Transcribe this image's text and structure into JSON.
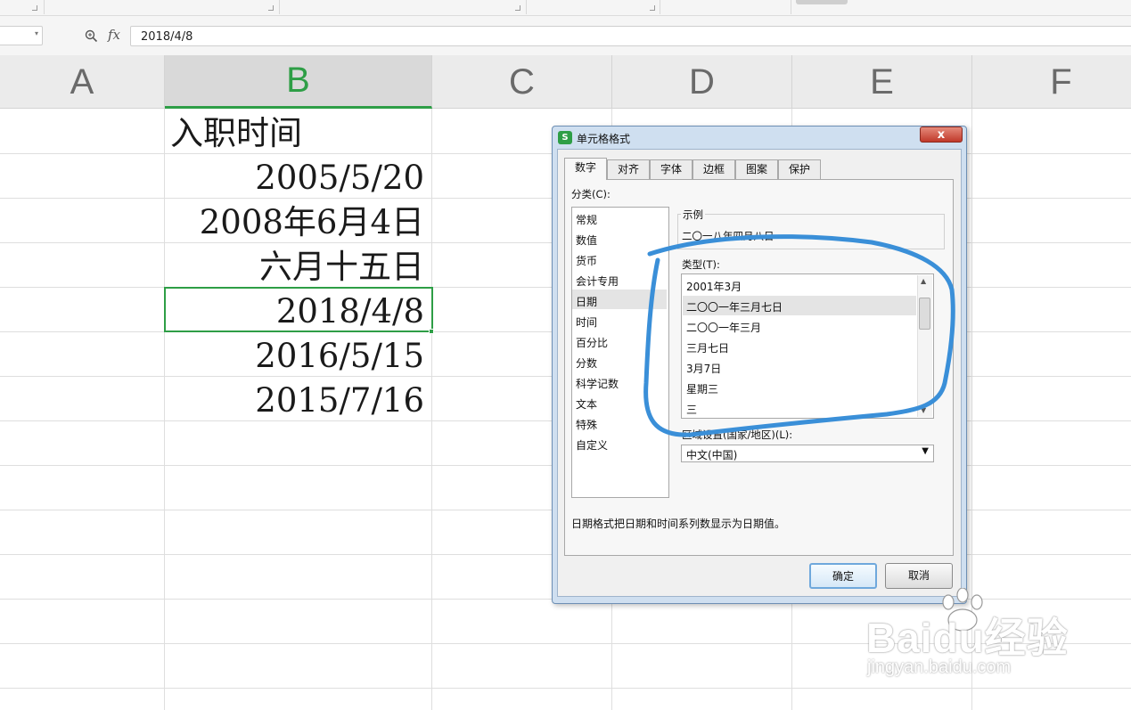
{
  "formula_bar": {
    "fx_label": "fx",
    "value": "2018/4/8"
  },
  "columns": [
    "A",
    "B",
    "C",
    "D",
    "E",
    "F"
  ],
  "selected_column": "B",
  "cells": {
    "b1": "入职时间",
    "b2": "2005/5/20",
    "b3": "2008年6月4日",
    "b4": "六月十五日",
    "b5": "2018/4/8",
    "b6": "2016/5/15",
    "b7": "2015/7/16"
  },
  "dialog": {
    "logo_letter": "S",
    "title": "单元格格式",
    "close_label": "x",
    "tabs": [
      "数字",
      "对齐",
      "字体",
      "边框",
      "图案",
      "保护"
    ],
    "category_label": "分类(C):",
    "categories": [
      "常规",
      "数值",
      "货币",
      "会计专用",
      "日期",
      "时间",
      "百分比",
      "分数",
      "科学记数",
      "文本",
      "特殊",
      "自定义"
    ],
    "selected_category": "日期",
    "sample_label": "示例",
    "sample_value": "二〇一八年四月八日",
    "type_label": "类型(T):",
    "types": [
      "2001年3月",
      "二〇〇一年三月七日",
      "二〇〇一年三月",
      "三月七日",
      "3月7日",
      "星期三",
      "三"
    ],
    "selected_type": "二〇〇一年三月七日",
    "region_label": "区域设置(国家/地区)(L):",
    "region_value": "中文(中国)",
    "description": "日期格式把日期和时间系列数显示为日期值。",
    "ok_label": "确定",
    "cancel_label": "取消"
  },
  "watermark": {
    "brand": "Baidu经验",
    "url": "jingyan.baidu.com"
  },
  "colors": {
    "accent_green": "#2e9e46",
    "annotation_blue": "#3a8fd8",
    "dialog_frame": "#cfdff0"
  }
}
